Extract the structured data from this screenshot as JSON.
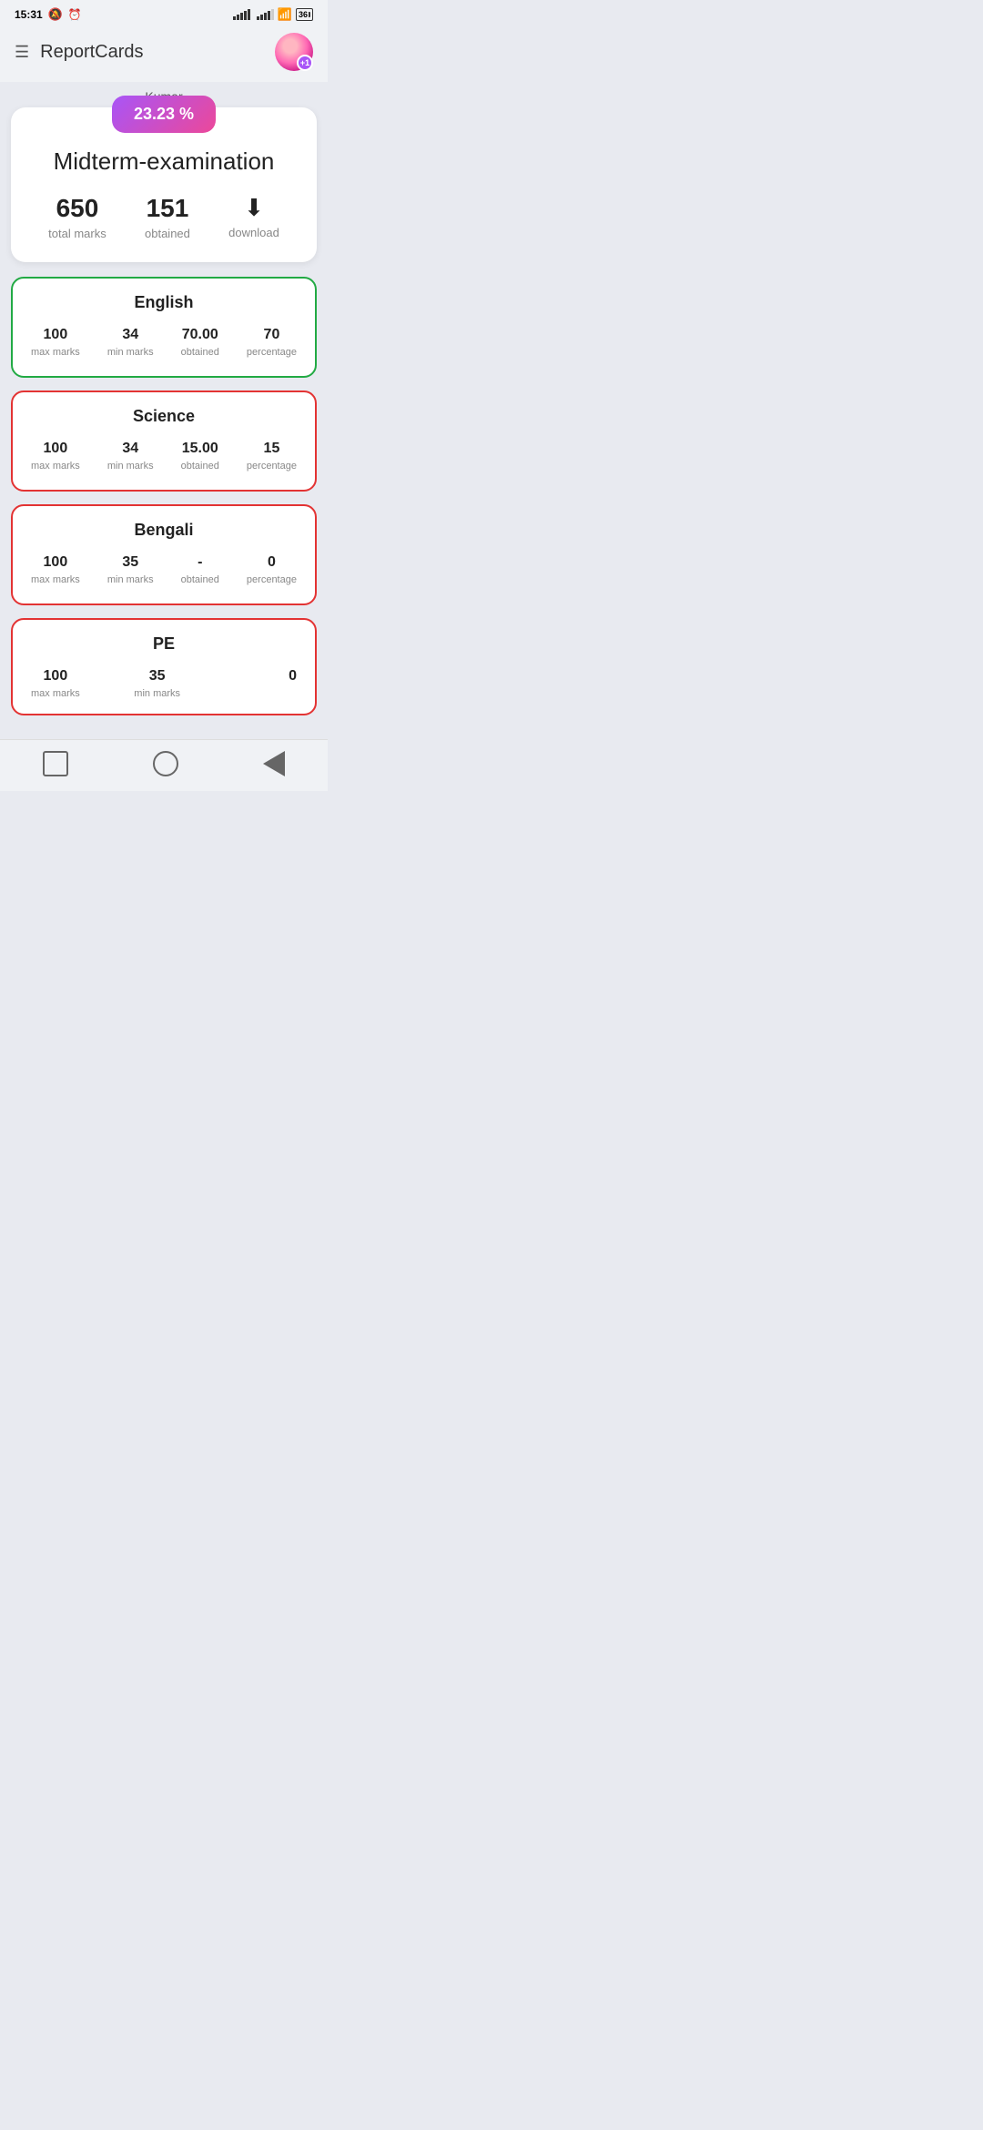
{
  "statusBar": {
    "time": "15:31",
    "battery": "36"
  },
  "header": {
    "title": "ReportCards",
    "avatarBadge": "+1"
  },
  "student": {
    "name": "Kumar"
  },
  "summary": {
    "percentage": "23.23 %",
    "examTitle": "Midterm-examination",
    "totalMarks": "650",
    "totalMarksLabel": "total marks",
    "obtainedMarks": "151",
    "obtainedMarksLabel": "obtained",
    "downloadLabel": "download"
  },
  "subjects": [
    {
      "name": "English",
      "borderClass": "pass",
      "maxMarks": "100",
      "minMarks": "34",
      "obtained": "70.00",
      "percentage": "70"
    },
    {
      "name": "Science",
      "borderClass": "fail",
      "maxMarks": "100",
      "minMarks": "34",
      "obtained": "15.00",
      "percentage": "15"
    },
    {
      "name": "Bengali",
      "borderClass": "fail",
      "maxMarks": "100",
      "minMarks": "35",
      "obtained": "-",
      "percentage": "0"
    },
    {
      "name": "PE",
      "borderClass": "fail",
      "maxMarks": "100",
      "minMarks": "35",
      "obtained": "-",
      "percentage": "0"
    }
  ],
  "labels": {
    "maxMarks": "max marks",
    "minMarks": "min marks",
    "obtained": "obtained",
    "percentage": "percentage"
  }
}
